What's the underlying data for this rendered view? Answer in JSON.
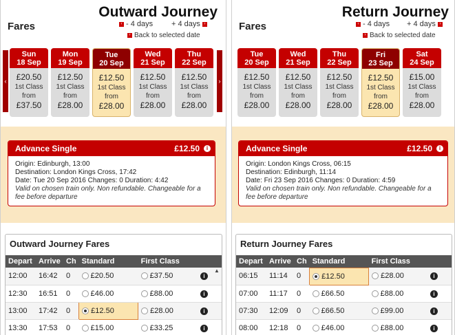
{
  "outward": {
    "fares_label": "Fares",
    "title": "Outward Journey",
    "minus_days": "- 4 days",
    "plus_days": "+ 4 days",
    "back_link": "Back to selected date",
    "days": [
      {
        "dow": "Sun",
        "date": "18 Sep",
        "price": "£20.50",
        "cls1": "1st Class",
        "cls2": "from",
        "price2": "£37.50",
        "selected": false
      },
      {
        "dow": "Mon",
        "date": "19 Sep",
        "price": "£12.50",
        "cls1": "1st Class",
        "cls2": "from",
        "price2": "£28.00",
        "selected": false
      },
      {
        "dow": "Tue",
        "date": "20 Sep",
        "price": "£12.50",
        "cls1": "1st Class",
        "cls2": "from",
        "price2": "£28.00",
        "selected": true
      },
      {
        "dow": "Wed",
        "date": "21 Sep",
        "price": "£12.50",
        "cls1": "1st Class",
        "cls2": "from",
        "price2": "£28.00",
        "selected": false
      },
      {
        "dow": "Thu",
        "date": "22 Sep",
        "price": "£12.50",
        "cls1": "1st Class",
        "cls2": "from",
        "price2": "£28.00",
        "selected": false
      }
    ],
    "detail": {
      "name": "Advance Single",
      "price": "£12.50",
      "origin": "Origin:  Edinburgh, 13:00",
      "destination": "Destination:  London Kings Cross, 17:42",
      "date": "Date:  Tue 20 Sep 2016 Changes:  0 Duration:  4:42",
      "note": "Valid on chosen train only. Non refundable. Changeable for a fee before departure"
    },
    "table_title": "Outward Journey Fares",
    "headers": [
      "Depart",
      "Arrive",
      "Ch",
      "Standard",
      "First Class"
    ],
    "rows": [
      {
        "depart": "12:00",
        "arrive": "16:42",
        "ch": "0",
        "std": "£20.50",
        "first": "£37.50",
        "std_sel": false
      },
      {
        "depart": "12:30",
        "arrive": "16:51",
        "ch": "0",
        "std": "£46.00",
        "first": "£88.00",
        "std_sel": false
      },
      {
        "depart": "13:00",
        "arrive": "17:42",
        "ch": "0",
        "std": "£12.50",
        "first": "£28.00",
        "std_sel": true
      },
      {
        "depart": "13:30",
        "arrive": "17:53",
        "ch": "0",
        "std": "£15.00",
        "first": "£33.25",
        "std_sel": false
      }
    ]
  },
  "return": {
    "fares_label": "Fares",
    "title": "Return Journey",
    "minus_days": "- 4 days",
    "plus_days": "+ 4 days",
    "back_link": "Back to selected date",
    "days": [
      {
        "dow": "Tue",
        "date": "20 Sep",
        "price": "£12.50",
        "cls1": "1st Class",
        "cls2": "from",
        "price2": "£28.00",
        "selected": false
      },
      {
        "dow": "Wed",
        "date": "21 Sep",
        "price": "£12.50",
        "cls1": "1st Class",
        "cls2": "from",
        "price2": "£28.00",
        "selected": false
      },
      {
        "dow": "Thu",
        "date": "22 Sep",
        "price": "£12.50",
        "cls1": "1st Class",
        "cls2": "from",
        "price2": "£28.00",
        "selected": false
      },
      {
        "dow": "Fri",
        "date": "23 Sep",
        "price": "£12.50",
        "cls1": "1st Class",
        "cls2": "from",
        "price2": "£28.00",
        "selected": true
      },
      {
        "dow": "Sat",
        "date": "24 Sep",
        "price": "£15.00",
        "cls1": "1st Class",
        "cls2": "from",
        "price2": "£28.00",
        "selected": false
      }
    ],
    "detail": {
      "name": "Advance Single",
      "price": "£12.50",
      "origin": "Origin:  London Kings Cross, 06:15",
      "destination": "Destination:  Edinburgh, 11:14",
      "date": "Date:  Fri 23 Sep 2016 Changes:  0 Duration:  4:59",
      "note": "Valid on chosen train only. Non refundable. Changeable for a fee before departure"
    },
    "table_title": "Return Journey Fares",
    "headers": [
      "Depart",
      "Arrive",
      "Ch",
      "Standard",
      "First Class"
    ],
    "rows": [
      {
        "depart": "06:15",
        "arrive": "11:14",
        "ch": "0",
        "std": "£12.50",
        "first": "£28.00",
        "std_sel": true
      },
      {
        "depart": "07:00",
        "arrive": "11:17",
        "ch": "0",
        "std": "£66.50",
        "first": "£88.00",
        "std_sel": false
      },
      {
        "depart": "07:30",
        "arrive": "12:09",
        "ch": "0",
        "std": "£66.50",
        "first": "£99.00",
        "std_sel": false
      },
      {
        "depart": "08:00",
        "arrive": "12:18",
        "ch": "0",
        "std": "£46.00",
        "first": "£88.00",
        "std_sel": false
      }
    ]
  }
}
